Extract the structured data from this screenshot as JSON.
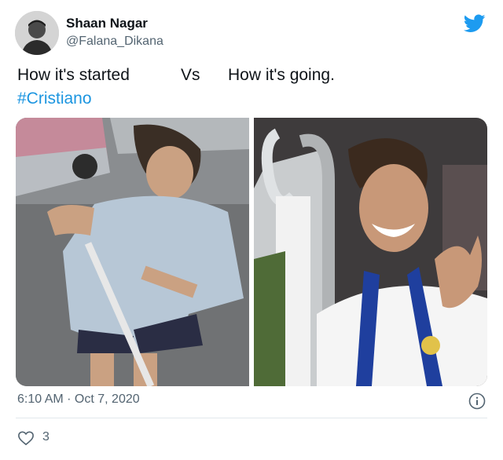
{
  "tweet": {
    "author_name": "Shaan Nagar",
    "author_handle": "@Falana_Dikana",
    "text_left": "How it's started",
    "text_vs": "Vs",
    "text_right": "How it's going.",
    "hashtag": "#Cristiano",
    "timestamp": "6:10 AM · Oct 7, 2020",
    "like_count": "3"
  },
  "icons": {
    "brand": "twitter-bird-icon",
    "info": "info-icon",
    "like": "heart-icon"
  },
  "colors": {
    "accent": "#1d9bf0",
    "hashtag": "#1b95e0",
    "muted": "#536471",
    "text": "#0f1419"
  }
}
